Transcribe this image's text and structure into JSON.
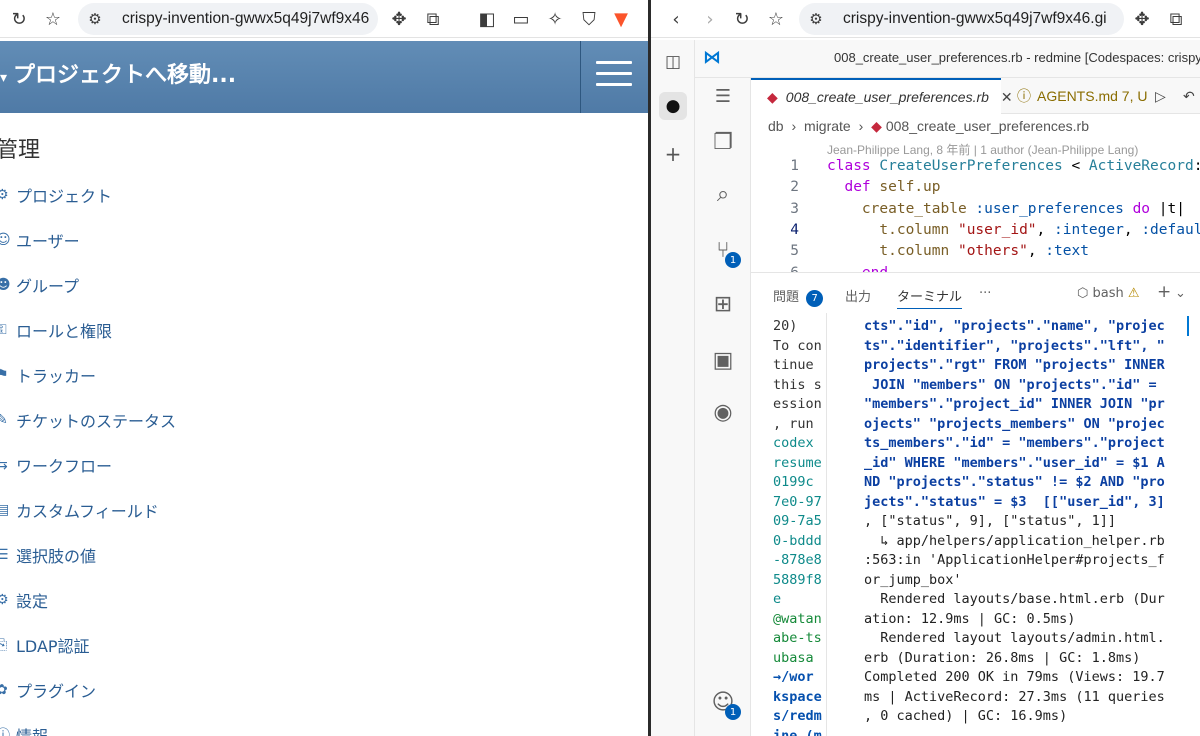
{
  "left_browser": {
    "url": "crispy-invention-gwwx5q49j7wf9x46",
    "redmine": {
      "jump_label": "プロジェクトへ移動...",
      "admin_title": "管理",
      "menu": [
        {
          "icon": "projects-icon",
          "glyph": "⚙",
          "label": "プロジェクト"
        },
        {
          "icon": "user-icon",
          "glyph": "☺",
          "label": "ユーザー"
        },
        {
          "icon": "group-icon",
          "glyph": "☻",
          "label": "グループ"
        },
        {
          "icon": "roles-icon",
          "glyph": "⚿",
          "label": "ロールと権限"
        },
        {
          "icon": "tracker-icon",
          "glyph": "⚑",
          "label": "トラッカー"
        },
        {
          "icon": "issue-status-icon",
          "glyph": "✎",
          "label": "チケットのステータス"
        },
        {
          "icon": "workflow-icon",
          "glyph": "⇆",
          "label": "ワークフロー"
        },
        {
          "icon": "custom-field-icon",
          "glyph": "▤",
          "label": "カスタムフィールド"
        },
        {
          "icon": "enumeration-icon",
          "glyph": "☰",
          "label": "選択肢の値"
        },
        {
          "icon": "settings-icon",
          "glyph": "⚙",
          "label": "設定"
        },
        {
          "icon": "ldap-icon",
          "glyph": "⎘",
          "label": "LDAP認証"
        },
        {
          "icon": "plugin-icon",
          "glyph": "✿",
          "label": "プラグイン"
        },
        {
          "icon": "info-icon",
          "glyph": "ⓘ",
          "label": "情報"
        }
      ]
    }
  },
  "right_browser": {
    "url": "crispy-invention-gwwx5q49j7wf9x46.gi",
    "vscode": {
      "window_title": "008_create_user_preferences.rb - redmine [Codespaces: crispy",
      "tabs": [
        {
          "label": "008_create_user_preferences.rb",
          "active": true
        },
        {
          "label": "AGENTS.md 7, U",
          "active": false
        }
      ],
      "breadcrumb": [
        "db",
        "migrate",
        "008_create_user_preferences.rb"
      ],
      "blame": "Jean-Philippe Lang, 8 年前 | 1 author (Jean-Philippe Lang)",
      "code_lines": [
        {
          "n": "1",
          "text": "class CreateUserPreferences < ActiveRecord::"
        },
        {
          "n": "2",
          "text": "  def self.up"
        },
        {
          "n": "3",
          "text": "    create_table :user_preferences do |t|"
        },
        {
          "n": "4",
          "text": "      t.column \"user_id\", :integer, :default"
        },
        {
          "n": "5",
          "text": "      t.column \"others\", :text"
        },
        {
          "n": "6",
          "text": "    end"
        }
      ],
      "panel_tabs": {
        "problems": "問題",
        "problems_count": "7",
        "output": "出力",
        "terminal": "ターミナル",
        "more": "···"
      },
      "shell": "bash",
      "source_control_badge": "1",
      "accounts_badge": "1",
      "terminal_left": [
        "20)",
        "To con",
        "tinue",
        "this s",
        "ession",
        ", run",
        "codex",
        "resume",
        " 0199c",
        "7e0-97",
        "09-7a5",
        "0-bddd",
        "-878e8",
        "5889f8",
        "e",
        "@watan",
        "abe-ts",
        "ubasa",
        "→/wor",
        "kspace",
        "s/redm",
        "ine (m"
      ],
      "terminal_right": [
        "cts\".\"id\", \"projects\".\"name\", \"projec",
        "ts\".\"identifier\", \"projects\".\"lft\", \"",
        "projects\".\"rgt\" FROM \"projects\" INNER",
        " JOIN \"members\" ON \"projects\".\"id\" =",
        "\"members\".\"project_id\" INNER JOIN \"pr",
        "ojects\" \"projects_members\" ON \"projec",
        "ts_members\".\"id\" = \"members\".\"project",
        "_id\" WHERE \"members\".\"user_id\" = $1 A",
        "ND \"projects\".\"status\" != $2 AND \"pro",
        "jects\".\"status\" = $3  [[\"user_id\", 3]",
        ", [\"status\", 9], [\"status\", 1]]",
        "  ↳ app/helpers/application_helper.rb",
        ":563:in 'ApplicationHelper#projects_f",
        "or_jump_box'",
        "  Rendered layouts/base.html.erb (Dur",
        "ation: 12.9ms | GC: 0.5ms)",
        "  Rendered layout layouts/admin.html.",
        "erb (Duration: 26.8ms | GC: 1.8ms)",
        "Completed 200 OK in 79ms (Views: 19.7",
        "ms | ActiveRecord: 27.3ms (11 queries",
        ", 0 cached) | GC: 16.9ms)"
      ]
    }
  }
}
